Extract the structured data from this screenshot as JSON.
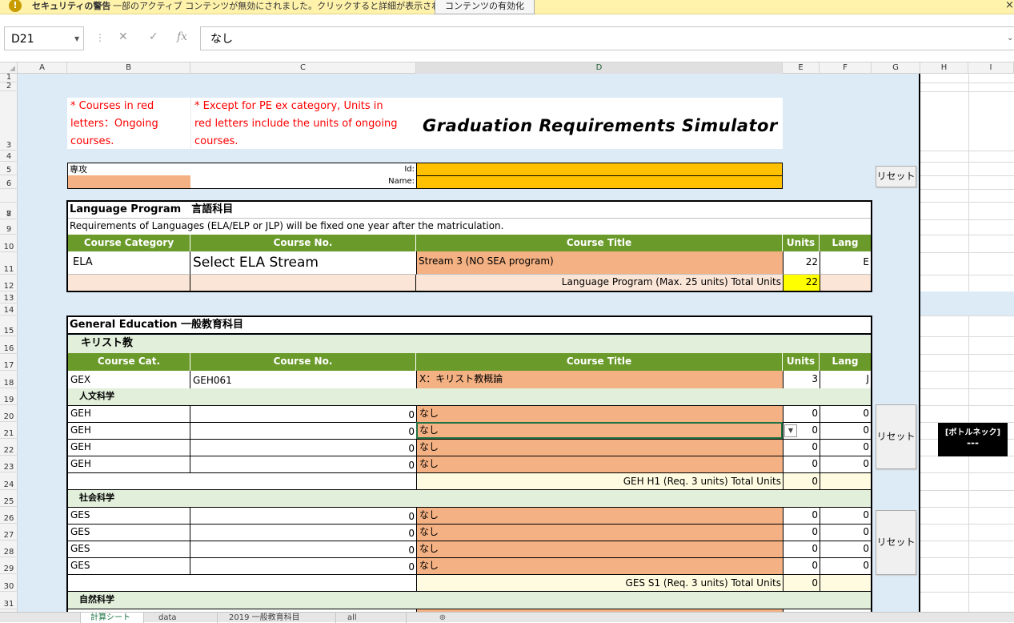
{
  "security_bar": {
    "title": "セキュリティの警告",
    "message": "一部のアクティブ コンテンツが無効にされました。クリックすると詳細が表示されます。",
    "button": "コンテンツの有効化",
    "close": "×",
    "icon": "!"
  },
  "formula_bar": {
    "name_box": "D21",
    "cancel_icon": "✕",
    "enter_icon": "✓",
    "fx_icon": "fx",
    "value": "なし",
    "expand_icon": "⌄"
  },
  "columns": [
    "A",
    "B",
    "C",
    "D",
    "E",
    "F",
    "G",
    "H",
    "I"
  ],
  "rows": [
    "1",
    "2",
    "3",
    "4",
    "5",
    "6",
    "7",
    "8",
    "9",
    "10",
    "11",
    "12",
    "13",
    "14",
    "15",
    "16",
    "17",
    "18",
    "19",
    "20",
    "21",
    "22",
    "23",
    "24",
    "25",
    "26",
    "27",
    "28",
    "29",
    "30",
    "31"
  ],
  "notes": {
    "note1": [
      "* Courses in red",
      "letters：Ongoing",
      "courses."
    ],
    "note2": [
      "* Except for PE ex category, Units in",
      "red letters include the units of ongoing",
      "courses."
    ],
    "title": "Graduation Requirements Simulator"
  },
  "profile": {
    "major_label": "専攻",
    "id_label": "Id:",
    "name_label": "Name:"
  },
  "reset_label": "リセット",
  "language": {
    "header": "Language Program　言語科目",
    "note": "Requirements of Languages (ELA/ELP or JLP) will be fixed one year after the matriculation.",
    "col_headers": [
      "Course Category",
      "Course No.",
      "Course Title",
      "Units",
      "Lang"
    ],
    "row": {
      "category": "ELA",
      "course_no": "Select ELA Stream",
      "title": "Stream 3 (NO SEA program)",
      "units": "22",
      "lang": "E"
    },
    "total_label": "Language Program (Max. 25 units) Total Units",
    "total_value": "22"
  },
  "general": {
    "header": "General Education 一般教育科目",
    "christianity": {
      "label": "キリスト教",
      "col_headers": [
        "Course Cat.",
        "Course No.",
        "Course Title",
        "Units",
        "Lang"
      ],
      "row": {
        "category": "GEX",
        "course_no": "GEH061",
        "title": "X：キリスト教概論",
        "units": "3",
        "lang": "J"
      }
    },
    "humanities": {
      "label": "人文科学",
      "rows": [
        {
          "category": "GEH",
          "course_no": "0",
          "title": "なし",
          "units": "0",
          "lang": "0"
        },
        {
          "category": "GEH",
          "course_no": "0",
          "title": "なし",
          "units": "0",
          "lang": "0"
        },
        {
          "category": "GEH",
          "course_no": "0",
          "title": "なし",
          "units": "0",
          "lang": "0"
        },
        {
          "category": "GEH",
          "course_no": "0",
          "title": "なし",
          "units": "0",
          "lang": "0"
        }
      ],
      "total_label": "GEH H1 (Req. 3 units) Total Units",
      "total_value": "0"
    },
    "social": {
      "label": "社会科学",
      "rows": [
        {
          "category": "GES",
          "course_no": "0",
          "title": "なし",
          "units": "0",
          "lang": "0"
        },
        {
          "category": "GES",
          "course_no": "0",
          "title": "なし",
          "units": "0",
          "lang": "0"
        },
        {
          "category": "GES",
          "course_no": "0",
          "title": "なし",
          "units": "0",
          "lang": "0"
        },
        {
          "category": "GES",
          "course_no": "0",
          "title": "なし",
          "units": "0",
          "lang": "0"
        }
      ],
      "total_label": "GES S1 (Req. 3 units) Total Units",
      "total_value": "0"
    },
    "natural": {
      "label": "自然科学"
    }
  },
  "bottleneck": {
    "title": "[ボトルネック]",
    "value": "---"
  },
  "sheet_tabs": [
    "計算シート",
    "data",
    "2019 一般教育科目",
    "all"
  ],
  "colors": {
    "green_header": "#6a9a2a",
    "salmon": "#f4b183",
    "orange": "#ffc000",
    "yellow": "#ffff00",
    "sheet_blue": "#ddebf7",
    "note_red": "#ff0000"
  }
}
